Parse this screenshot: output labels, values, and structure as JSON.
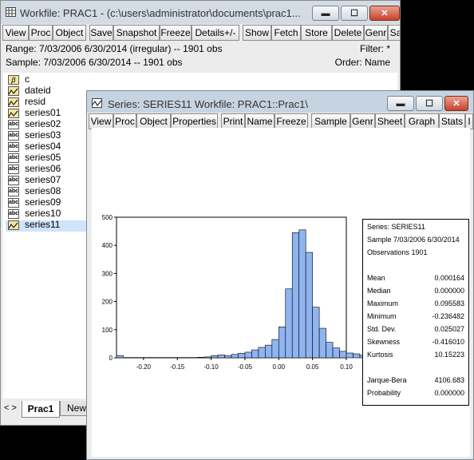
{
  "workfile": {
    "title": "Workfile: PRAC1 - (c:\\users\\administrator\\documents\\prac1...",
    "toolbar": [
      "View",
      "Proc",
      "Object",
      "Save",
      "Snapshot",
      "Freeze",
      "Details+/-",
      "Show",
      "Fetch",
      "Store",
      "Delete",
      "Genr",
      "Sa"
    ],
    "range_text": "Range:  7/03/2006 6/30/2014 (irregular)  --   1901 obs",
    "filter_text": "Filter: *",
    "sample_text": "Sample: 7/03/2006 6/30/2014  --   1901 obs",
    "order_text": "Order: Name",
    "objects": [
      {
        "name": "c",
        "icon": "coef-icon"
      },
      {
        "name": "dateid",
        "icon": "series-icon"
      },
      {
        "name": "resid",
        "icon": "series-icon"
      },
      {
        "name": "series01",
        "icon": "series-icon"
      },
      {
        "name": "series02",
        "icon": "alpha-icon"
      },
      {
        "name": "series03",
        "icon": "alpha-icon"
      },
      {
        "name": "series04",
        "icon": "alpha-icon"
      },
      {
        "name": "series05",
        "icon": "alpha-icon"
      },
      {
        "name": "series06",
        "icon": "alpha-icon"
      },
      {
        "name": "series07",
        "icon": "alpha-icon"
      },
      {
        "name": "series08",
        "icon": "alpha-icon"
      },
      {
        "name": "series09",
        "icon": "alpha-icon"
      },
      {
        "name": "series10",
        "icon": "alpha-icon"
      },
      {
        "name": "series11",
        "icon": "series-icon",
        "selected": true
      }
    ],
    "tabs": {
      "nav": "< >",
      "active": "Prac1",
      "new": "New"
    }
  },
  "series_window": {
    "title": "Series: SERIES11    Workfile: PRAC1::Prac1\\",
    "toolbar": [
      "View",
      "Proc",
      "Object",
      "Properties",
      "Print",
      "Name",
      "Freeze",
      "Sample",
      "Genr",
      "Sheet",
      "Graph",
      "Stats",
      "I"
    ],
    "stats": {
      "header": [
        "Series: SERIES11",
        "Sample 7/03/2006 6/30/2014",
        "Observations 1901"
      ],
      "rows": [
        {
          "k": "Mean",
          "v": "0.000164"
        },
        {
          "k": "Median",
          "v": "0.000000"
        },
        {
          "k": "Maximum",
          "v": "0.095583"
        },
        {
          "k": "Minimum",
          "v": "-0.236482"
        },
        {
          "k": "Std. Dev.",
          "v": "0.025027"
        },
        {
          "k": "Skewness",
          "v": "-0.416010"
        },
        {
          "k": "Kurtosis",
          "v": "10.15223"
        }
      ],
      "tests": [
        {
          "k": "Jarque-Bera",
          "v": "4106.683"
        },
        {
          "k": "Probability",
          "v": "0.000000"
        }
      ]
    }
  },
  "chart_data": {
    "type": "bar",
    "x_bins_start": -0.24,
    "bin_width": 0.01,
    "values": [
      8,
      1,
      1,
      1,
      1,
      1,
      1,
      1,
      1,
      1,
      1,
      1,
      2,
      3,
      8,
      10,
      8,
      12,
      16,
      20,
      28,
      37,
      45,
      65,
      110,
      245,
      445,
      455,
      375,
      180,
      105,
      55,
      35,
      23,
      17,
      14,
      9,
      6,
      4,
      3
    ],
    "xticks": [
      "-0.20",
      "-0.15",
      "-0.10",
      "-0.05",
      "0.00",
      "0.05",
      "0.10"
    ],
    "xtick_values": [
      -0.2,
      -0.15,
      -0.1,
      -0.05,
      0.0,
      0.05,
      0.1
    ],
    "yticks": [
      "0",
      "100",
      "200",
      "300",
      "400",
      "500"
    ],
    "ytick_values": [
      0,
      100,
      200,
      300,
      400,
      500
    ],
    "xlim": [
      -0.24,
      0.1
    ],
    "ylim": [
      0,
      500
    ],
    "bar_color": "#8fb4f0"
  }
}
